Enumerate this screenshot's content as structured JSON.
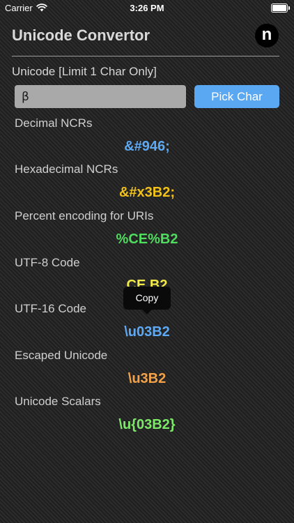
{
  "status_bar": {
    "carrier": "Carrier",
    "time": "3:26 PM"
  },
  "header": {
    "title": "Unicode Convertor",
    "logo_letter": "n"
  },
  "input": {
    "label": "Unicode [Limit 1 Char Only]",
    "value": "β",
    "pick_label": "Pick Char"
  },
  "rows": [
    {
      "label": "Decimal NCRs",
      "value": "&#946;",
      "color": "#5da9f4"
    },
    {
      "label": "Hexadecimal NCRs",
      "value": "&#x3B2;",
      "color": "#f2c21b"
    },
    {
      "label": "Percent encoding for URIs",
      "value": "%CE%B2",
      "color": "#4fdc5f"
    },
    {
      "label": "UTF-8 Code",
      "value": "CE B2",
      "color": "#f1e84a"
    },
    {
      "label": "UTF-16 Code",
      "value": "\\u03B2",
      "color": "#5da9f4"
    },
    {
      "label": "Escaped Unicode",
      "value": "\\u3B2",
      "color": "#f2a24a"
    },
    {
      "label": "Unicode Scalars",
      "value": "\\u{03B2}",
      "color": "#7ee86a"
    }
  ],
  "tooltip": {
    "label": "Copy"
  }
}
